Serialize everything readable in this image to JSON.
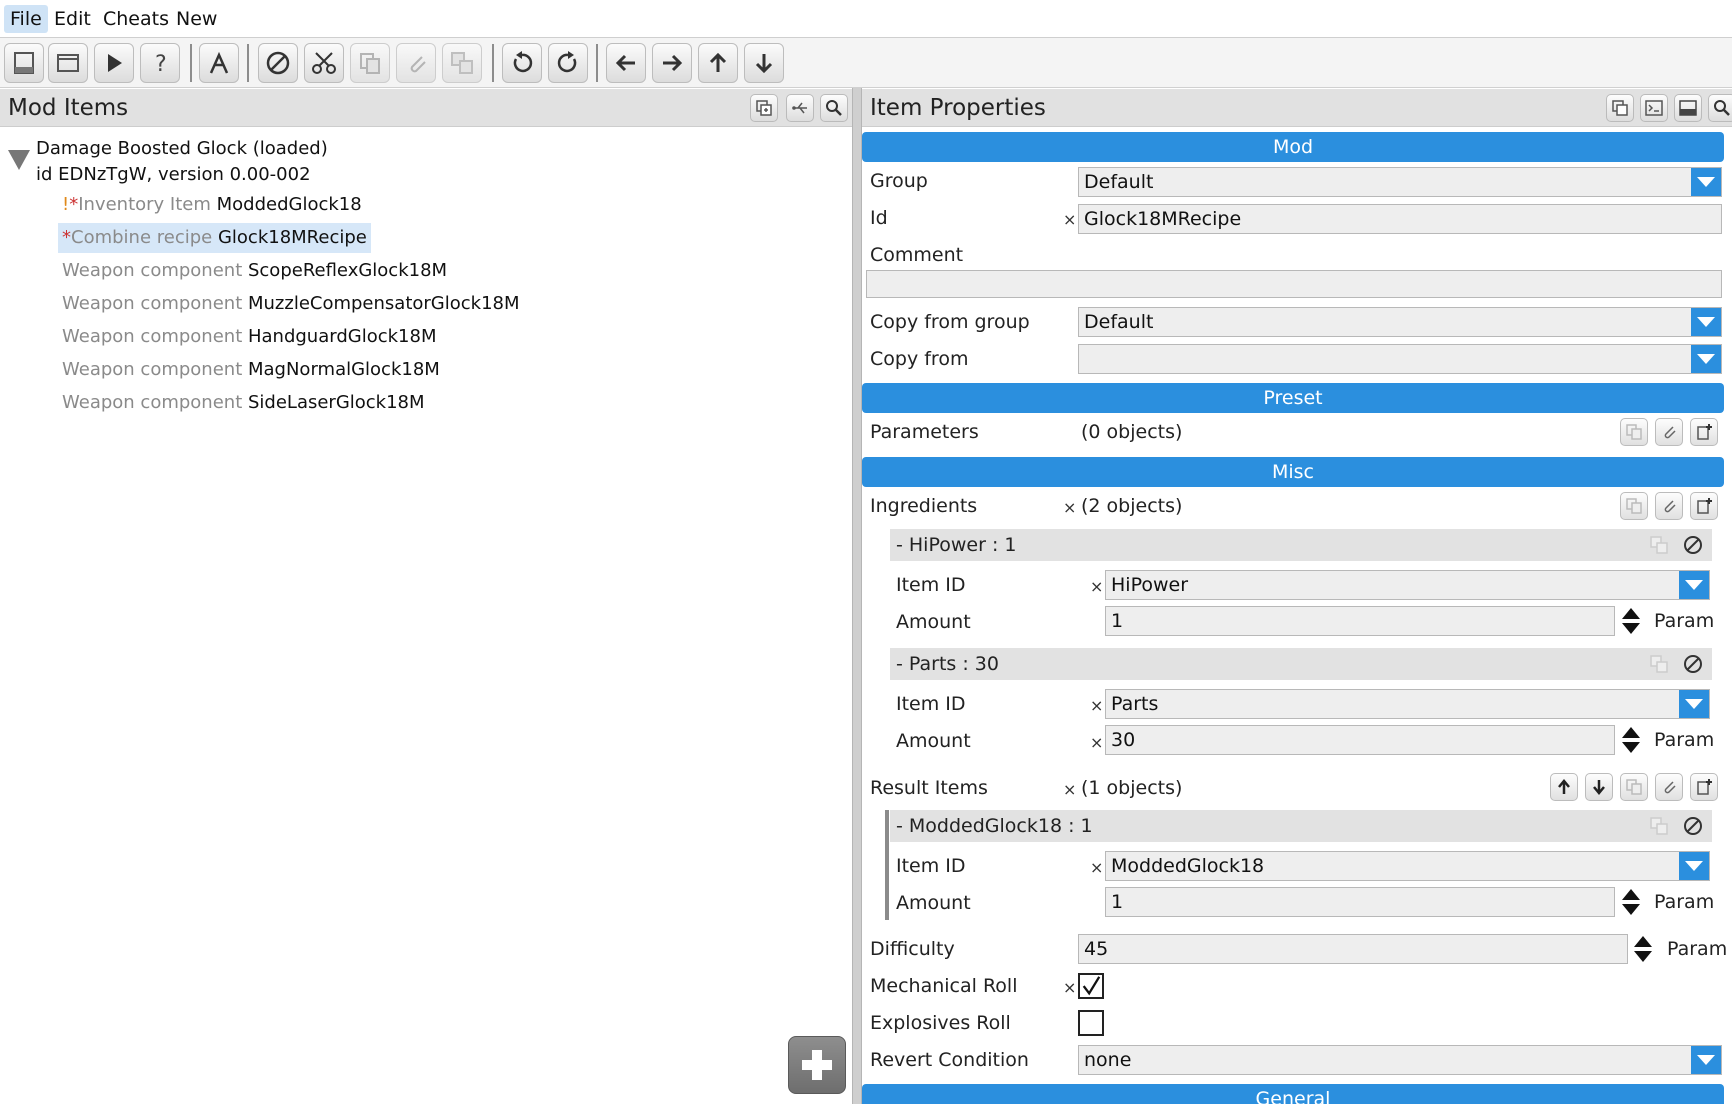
{
  "menu": {
    "file": "File",
    "edit": "Edit",
    "cheats": "Cheats",
    "new": "New"
  },
  "left_panel": {
    "title": "Mod Items",
    "root": {
      "name": "Damage Boosted Glock (loaded)",
      "meta": "id EDNzTgW, version 0.00-002"
    },
    "items": [
      {
        "warn": "!",
        "mod": "*",
        "type": "Inventory Item",
        "name": "ModdedGlock18"
      },
      {
        "warn": "",
        "mod": "*",
        "type": "Combine recipe",
        "name": "Glock18MRecipe"
      },
      {
        "warn": "",
        "mod": "",
        "type": "Weapon component",
        "name": "ScopeReflexGlock18M"
      },
      {
        "warn": "",
        "mod": "",
        "type": "Weapon component",
        "name": "MuzzleCompensatorGlock18M"
      },
      {
        "warn": "",
        "mod": "",
        "type": "Weapon component",
        "name": "HandguardGlock18M"
      },
      {
        "warn": "",
        "mod": "",
        "type": "Weapon component",
        "name": "MagNormalGlock18M"
      },
      {
        "warn": "",
        "mod": "",
        "type": "Weapon component",
        "name": "SideLaserGlock18M"
      }
    ]
  },
  "right_panel": {
    "title": "Item Properties",
    "sections": {
      "mod": "Mod",
      "preset": "Preset",
      "misc": "Misc",
      "general": "General"
    },
    "mod": {
      "group_label": "Group",
      "group_value": "Default",
      "id_label": "Id",
      "id_value": "Glock18MRecipe",
      "comment_label": "Comment",
      "comment_value": "",
      "copy_group_label": "Copy from group",
      "copy_group_value": "Default",
      "copy_from_label": "Copy from",
      "copy_from_value": ""
    },
    "preset": {
      "params_label": "Parameters",
      "params_value": "(0 objects)"
    },
    "misc": {
      "ingredients_label": "Ingredients",
      "ingredients_value": "(2 objects)",
      "ingredients": [
        {
          "header": "- HiPower : 1",
          "item_id_label": "Item ID",
          "item_id": "HiPower",
          "amount_label": "Amount",
          "amount": "1",
          "param": "Param"
        },
        {
          "header": "- Parts : 30",
          "item_id_label": "Item ID",
          "item_id": "Parts",
          "amount_label": "Amount",
          "amount": "30",
          "param": "Param"
        }
      ],
      "results_label": "Result Items",
      "results_value": "(1 objects)",
      "results": [
        {
          "header": "- ModdedGlock18 : 1",
          "item_id_label": "Item ID",
          "item_id": "ModdedGlock18",
          "amount_label": "Amount",
          "amount": "1",
          "param": "Param"
        }
      ],
      "difficulty_label": "Difficulty",
      "difficulty_value": "45",
      "difficulty_param": "Param",
      "mech_roll_label": "Mechanical Roll",
      "mech_roll_checked": true,
      "expl_roll_label": "Explosives Roll",
      "expl_roll_checked": false,
      "revert_label": "Revert Condition",
      "revert_value": "none"
    },
    "x_mark": "×"
  },
  "icons": [
    "save-icon",
    "window-icon",
    "play-icon",
    "help-icon",
    "cursor-icon",
    "cancel-icon",
    "cut-icon",
    "copy-icon",
    "paste-icon",
    "duplicate-icon",
    "undo-icon",
    "redo-icon",
    "arrow-left-icon",
    "arrow-right-icon",
    "arrow-up-icon",
    "arrow-down-icon",
    "add-icon"
  ],
  "colors": {
    "section": "#2b8fde",
    "selected": "#d6e7f8",
    "warn": "#e08a1a",
    "modified": "#cc3333"
  }
}
